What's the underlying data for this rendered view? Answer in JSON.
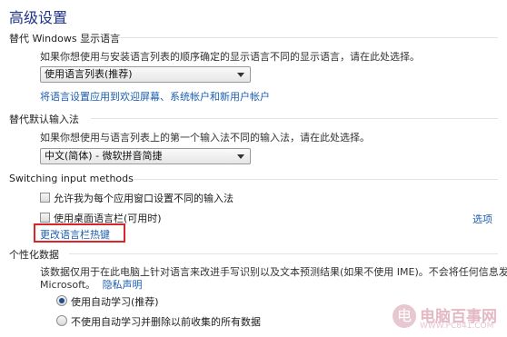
{
  "page_title": "高级设置",
  "display_language": {
    "heading": "替代 Windows 显示语言",
    "description": "如果你想使用与安装语言列表的顺序确定的显示语言不同的显示语言，请在此处选择。",
    "dropdown_value": "使用语言列表(推荐)",
    "link": "将语言设置应用到欢迎屏幕、系统帐户和新用户帐户"
  },
  "input_method": {
    "heading": "替代默认输入法",
    "description": "如果你想使用与语言列表上的第一个输入法不同的输入法，请在此处选择。",
    "dropdown_value": "中文(简体) - 微软拼音简捷"
  },
  "switching": {
    "heading": "Switching input methods",
    "checkbox_per_app": "允许我为每个应用窗口设置不同的输入法",
    "checkbox_language_bar": "使用桌面语言栏(可用时)",
    "options_link": "选项",
    "hotkey_link": "更改语言栏热键"
  },
  "personalization": {
    "heading": "个性化数据",
    "description_line1": "该数据仅用于在此电脑上针对语言来改进手写识别以及文本预测结果(如果不使用 IME)。不会将任何信息发送到",
    "description_line2": "Microsoft。",
    "privacy_link": "隐私声明",
    "radio_auto": "使用自动学习(推荐)",
    "radio_no_auto": "不使用自动学习并删除以前收集的所有数据",
    "selected": "radio_auto"
  },
  "watermark": {
    "logo_char": "电",
    "name": "电脑百事网",
    "url": "WWW.PC841.COM"
  },
  "colors": {
    "title": "#1e3287",
    "link": "#1c5fb0",
    "highlight_box": "#d9252a"
  }
}
